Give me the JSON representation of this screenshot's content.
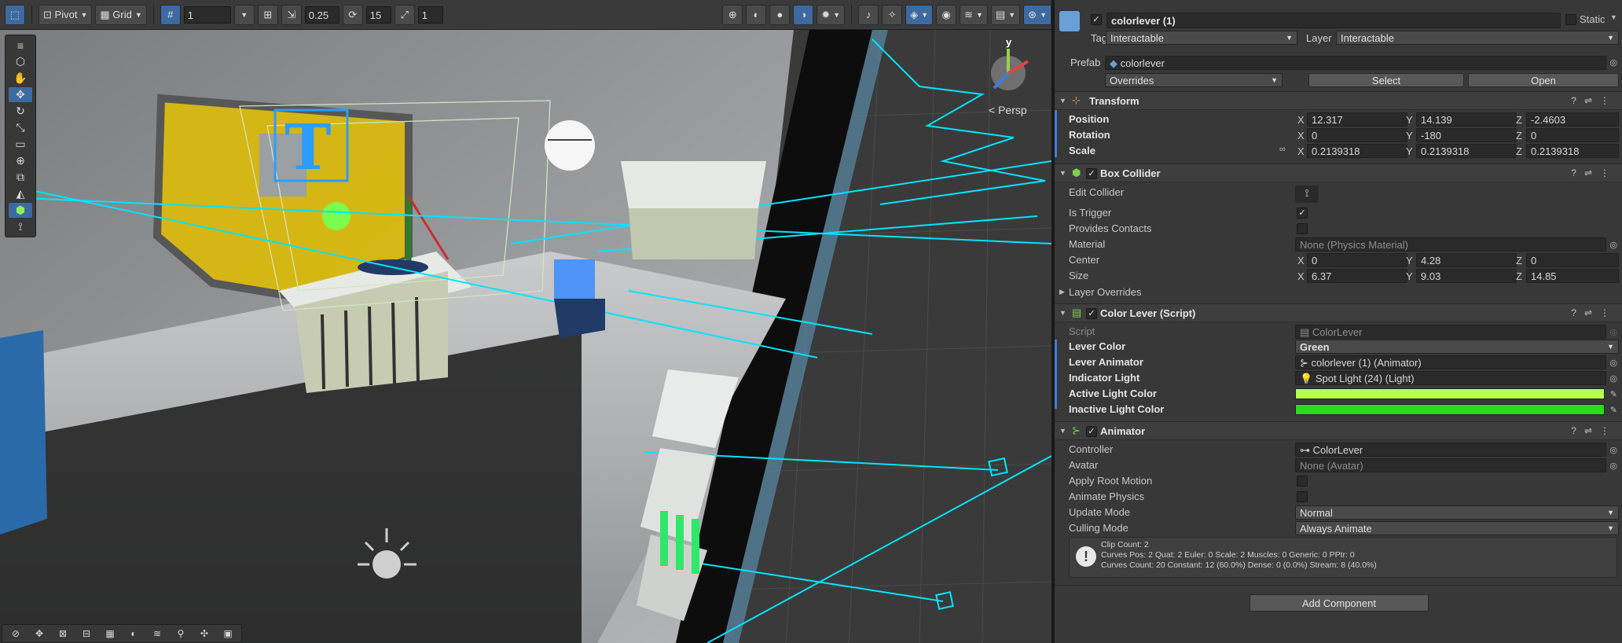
{
  "scene_toolbar": {
    "pivot_label": "Pivot",
    "grid_label": "Grid",
    "grid_size": "1",
    "snap_value": "0.25",
    "rotate_snap": "15",
    "scale_snap": "1"
  },
  "scene": {
    "persp_label": "< Persp",
    "axis_y": "y"
  },
  "header": {
    "object_name": "colorlever (1)",
    "static_label": "Static",
    "tag_label": "Tag",
    "tag_value": "Interactable",
    "layer_label": "Layer",
    "layer_value": "Interactable",
    "prefab_label": "Prefab",
    "prefab_value": "colorlever",
    "overrides_label": "Overrides",
    "select_label": "Select",
    "open_label": "Open"
  },
  "transform": {
    "title": "Transform",
    "position_label": "Position",
    "rotation_label": "Rotation",
    "scale_label": "Scale",
    "position": {
      "x": "12.317",
      "y": "14.139",
      "z": "-2.4603"
    },
    "rotation": {
      "x": "0",
      "y": "-180",
      "z": "0"
    },
    "scale": {
      "x": "0.2139318",
      "y": "0.2139318",
      "z": "0.2139318"
    }
  },
  "box_collider": {
    "title": "Box Collider",
    "edit_collider_label": "Edit Collider",
    "is_trigger_label": "Is Trigger",
    "provides_contacts_label": "Provides Contacts",
    "material_label": "Material",
    "material_value": "None (Physics Material)",
    "center_label": "Center",
    "size_label": "Size",
    "center": {
      "x": "0",
      "y": "4.28",
      "z": "0"
    },
    "size": {
      "x": "6.37",
      "y": "9.03",
      "z": "14.85"
    },
    "layer_overrides_label": "Layer Overrides"
  },
  "color_lever": {
    "title": "Color Lever (Script)",
    "script_label": "Script",
    "script_value": "ColorLever",
    "lever_color_label": "Lever Color",
    "lever_color_value": "Green",
    "lever_animator_label": "Lever Animator",
    "lever_animator_value": "colorlever (1) (Animator)",
    "indicator_light_label": "Indicator Light",
    "indicator_light_value": "Spot Light (24) (Light)",
    "active_light_color_label": "Active Light Color",
    "inactive_light_color_label": "Inactive Light Color",
    "active_light_color": "#b6ff4e",
    "inactive_light_color": "#22e012"
  },
  "animator": {
    "title": "Animator",
    "controller_label": "Controller",
    "controller_value": "ColorLever",
    "avatar_label": "Avatar",
    "avatar_value": "None (Avatar)",
    "apply_root_motion_label": "Apply Root Motion",
    "animate_physics_label": "Animate Physics",
    "update_mode_label": "Update Mode",
    "update_mode_value": "Normal",
    "culling_mode_label": "Culling Mode",
    "culling_mode_value": "Always Animate",
    "info_line1": "Clip Count: 2",
    "info_line2": "Curves Pos: 2 Quat: 2 Euler: 0 Scale: 2 Muscles: 0 Generic: 0 PPtr: 0",
    "info_line3": "Curves Count: 20 Constant: 12 (60.0%) Dense: 0 (0.0%) Stream: 8 (40.0%)"
  },
  "add_component_label": "Add Component",
  "axes": {
    "x": "X",
    "y": "Y",
    "z": "Z"
  },
  "colors": {
    "accent": "#3d6aa0",
    "gizmo": "#00e5ff"
  }
}
